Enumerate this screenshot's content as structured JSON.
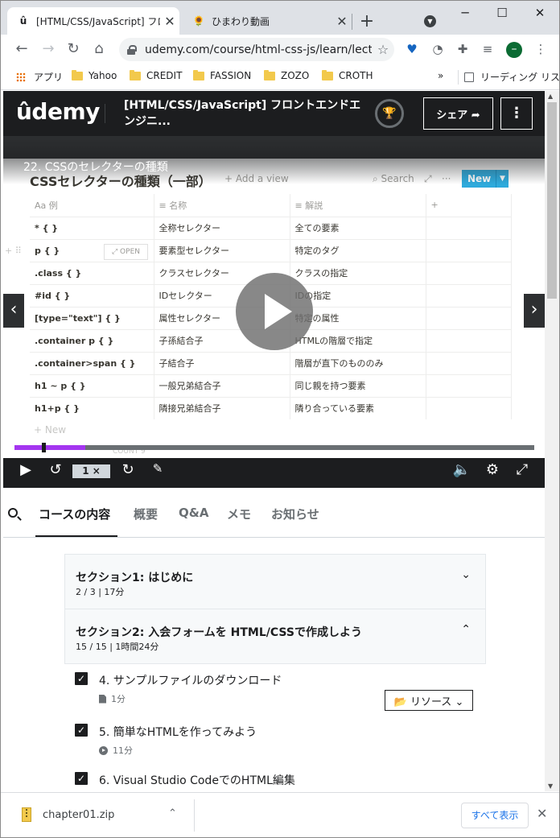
{
  "browser": {
    "tabs": [
      {
        "title": "[HTML/CSS/JavaScript] フロン",
        "favicon": "û"
      },
      {
        "title": "ひまわり動画",
        "favicon": "🌻"
      }
    ],
    "url": "udemy.com/course/html-css-js/learn/lect...",
    "bookmarks": [
      "アプリ",
      "Yahoo",
      "CREDIT",
      "FASSION",
      "ZOZO",
      "CROTH"
    ],
    "bookmarks_overflow": "»",
    "reading_list": "リーディング リスト",
    "profile_initial": "–"
  },
  "udemy": {
    "logo": "ûdemy",
    "course_title": "[HTML/CSS/JavaScript] フロントエンドエンジニ...",
    "share_label": "シェア ➦",
    "more_label": "⋮"
  },
  "video": {
    "lecture_title": "22. CSSのセレクターの種類",
    "table_title": "CSSセレクターの種類（一部）",
    "add_view": "+ Add a view",
    "search": "Search",
    "new_label": "New",
    "columns": [
      "Aa 例",
      "≡ 名称",
      "≡ 解説",
      "+"
    ],
    "rows": [
      [
        "* { }",
        "全称セレクター",
        "全ての要素"
      ],
      [
        "p { }",
        "要素型セレクター",
        "特定のタグ"
      ],
      [
        ".class { }",
        "クラスセレクター",
        "クラスの指定"
      ],
      [
        "#id { }",
        "IDセレクター",
        "IDの指定"
      ],
      [
        "[type=\"text\"] { }",
        "属性セレクター",
        "特定の属性"
      ],
      [
        ".container p { }",
        "子孫結合子",
        "HTMLの階層で指定"
      ],
      [
        ".container>span { }",
        "子結合子",
        "階層が直下のもののみ"
      ],
      [
        "h1 ~ p { }",
        "一般兄弟結合子",
        "同じ親を持つ要素"
      ],
      [
        "h1+p { }",
        "隣接兄弟結合子",
        "隣り合っている要素"
      ]
    ],
    "open_label": "⤢ OPEN",
    "add_new": "+ New",
    "count": "COUNT 9",
    "speed": "1 ×",
    "progress_fraction": 0.136
  },
  "course_tabs": [
    "コースの内容",
    "概要",
    "Q&A",
    "メモ",
    "お知らせ"
  ],
  "sections": [
    {
      "title": "セクション1: はじめに",
      "meta": "2 / 3 | 17分",
      "chevron": "⌄"
    },
    {
      "title": "セクション2: 入会フォームを HTML/CSSで作成しよう",
      "meta": "15 / 15 | 1時間24分",
      "chevron": "⌃"
    }
  ],
  "lectures": [
    {
      "title": "4. サンプルファイルのダウンロード",
      "meta": "1分",
      "icon": "document-icon"
    },
    {
      "title": "5. 簡単なHTMLを作ってみよう",
      "meta": "11分",
      "icon": "video-icon"
    },
    {
      "title": "6. Visual Studio CodeでのHTML編集",
      "meta": "",
      "icon": "video-icon"
    }
  ],
  "resource_button": "📂 リソース ⌄",
  "download": {
    "filename": "chapter01.zip",
    "show_all": "すべて表示"
  },
  "colors": {
    "udemy_dark": "#1c1d1f",
    "udemy_purple": "#a435f0",
    "notion_blue": "#2eaadc"
  }
}
